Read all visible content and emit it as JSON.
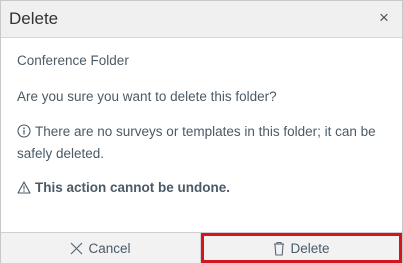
{
  "dialog": {
    "title": "Delete",
    "close_glyph": "×",
    "folder_name": "Conference Folder",
    "question": "Are you sure you want to delete this folder?",
    "info": "There are no surveys or templates in this folder; it can be safely deleted.",
    "warning": "This action cannot be undone.",
    "icons": {
      "info": "info-circle-icon",
      "warning": "warning-triangle-icon",
      "cancel": "x-icon",
      "delete": "trash-icon"
    }
  },
  "buttons": {
    "cancel_label": "Cancel",
    "delete_label": "Delete"
  },
  "colors": {
    "highlight": "#d4151b",
    "text": "#4a5b68",
    "titlebar": "#f0f0f0"
  }
}
